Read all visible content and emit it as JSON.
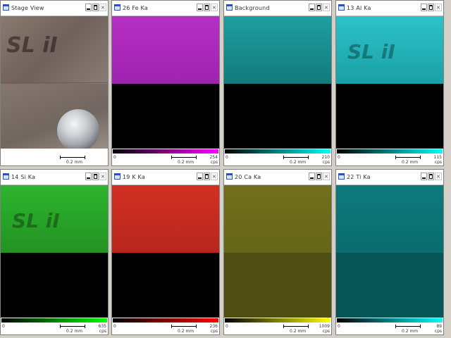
{
  "windows": [
    {
      "id": "stage-view",
      "title": "Stage View",
      "scale": "0.2 mm",
      "map": {
        "upper": "linear-gradient(135deg, #8a7a70 0%, #6f615b 50%, #8a7d77 100%)",
        "lower": "linear-gradient(160deg, #857770 0%, #726660 60%, #9a8f87 100%)",
        "text": "SL iI",
        "text_color": "#1a1010"
      },
      "colorbar": null,
      "min_label": "",
      "max_label": "",
      "unit": ""
    },
    {
      "id": "fe-ka",
      "title": "26 Fe Ka",
      "scale": "0.2 mm",
      "map": {
        "upper": "linear-gradient(180deg, #b62fc4 0%, #9f22b0 100%)",
        "lower": "#000000",
        "text": "",
        "text_color": "#5a0f67"
      },
      "colorbar": "linear-gradient(to right, #000000 0%, #ff00ff 100%)",
      "min_label": "0",
      "max_label": "254",
      "unit": "cps"
    },
    {
      "id": "background",
      "title": "Background",
      "scale": "0.2 mm",
      "map": {
        "upper": "linear-gradient(180deg, #1e9f9f 0%, #127a7c 100%)",
        "lower": "#000000",
        "text": "",
        "text_color": "#0c4b4d"
      },
      "colorbar": "linear-gradient(to right, #000000 0%, #00ffff 100%)",
      "min_label": "0",
      "max_label": "210",
      "unit": "cps"
    },
    {
      "id": "al-ka",
      "title": "13 Al Ka",
      "scale": "0.2 mm",
      "map": {
        "upper": "linear-gradient(180deg, #2bc3c8 0%, #1aa0a6 100%)",
        "lower": "#000000",
        "text": "SL iI",
        "text_color": "#0f3f41"
      },
      "colorbar": "linear-gradient(to right, #000000 0%, #00ffff 100%)",
      "min_label": "0",
      "max_label": "115",
      "unit": "cps"
    },
    {
      "id": "si-ka",
      "title": "14 Si Ka",
      "scale": "0.2 mm",
      "map": {
        "upper": "linear-gradient(180deg, #2eb52e 0%, #229222 100%)",
        "lower": "#000000",
        "text": "SL iI",
        "text_color": "#0f3d0f"
      },
      "colorbar": "linear-gradient(to right, #000000 0%, #00ff00 100%)",
      "min_label": "0",
      "max_label": "635",
      "unit": "cps"
    },
    {
      "id": "k-ka",
      "title": "19 K Ka",
      "scale": "0.2 mm",
      "map": {
        "upper": "linear-gradient(180deg, #d33023 0%, #b7261d 100%)",
        "lower": "#000000",
        "text": "",
        "text_color": "#5e0f0a"
      },
      "colorbar": "linear-gradient(to right, #000000 0%, #ff0000 100%)",
      "min_label": "0",
      "max_label": "236",
      "unit": "cps"
    },
    {
      "id": "ca-ka",
      "title": "20 Ca Ka",
      "scale": "0.2 mm",
      "map": {
        "upper": "linear-gradient(180deg, #6f6f1d 0%, #666617 100%)",
        "lower": "#4e4e13",
        "text": "",
        "text_color": "#3b3b0f"
      },
      "colorbar": "linear-gradient(to right, #000000 0%, #ffff00 100%)",
      "min_label": "0",
      "max_label": "1009",
      "unit": "cps"
    },
    {
      "id": "ti-ka",
      "title": "22 Ti Ka",
      "scale": "0.2 mm",
      "map": {
        "upper": "linear-gradient(180deg, #0e7a7c 0%, #0a6c6e 100%)",
        "lower": "#075556",
        "text": "",
        "text_color": "#053c3d"
      },
      "colorbar": "linear-gradient(to right, #000000 0%, #00ffff 100%)",
      "min_label": "0",
      "max_label": "89",
      "unit": "cps"
    }
  ]
}
